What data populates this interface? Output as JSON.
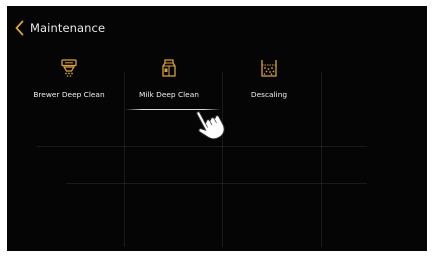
{
  "header": {
    "title": "Maintenance",
    "back_icon": "chevron-left-icon"
  },
  "tiles": [
    {
      "label": "Brewer Deep Clean",
      "icon": "brewer-icon"
    },
    {
      "label": "Milk Deep Clean",
      "icon": "milk-carton-icon"
    },
    {
      "label": "Descaling",
      "icon": "descaling-icon"
    }
  ],
  "selected_index": 1,
  "pointer_icon": "hand-pointer-icon",
  "colors": {
    "background": "#050505",
    "accent": "#d9a23c",
    "text": "#f0f0f0"
  }
}
